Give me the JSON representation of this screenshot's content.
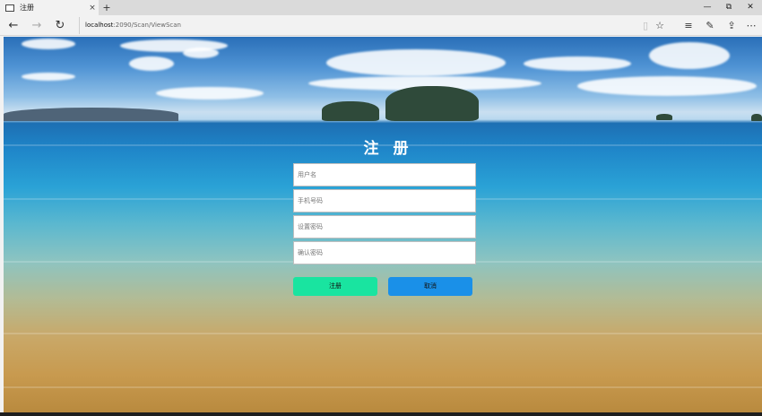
{
  "browser": {
    "tab_title": "注册",
    "new_tab": "+",
    "tab_close": "×",
    "window_controls": {
      "minimize": "—",
      "maximize": "⧉",
      "close": "✕"
    },
    "nav": {
      "back": "←",
      "forward": "→",
      "refresh": "↻"
    },
    "url_host": "localhost",
    "url_path": ":2090/Scan/ViewScan",
    "tools": {
      "reading_view": "▯",
      "favorite": "☆",
      "hub": "≡",
      "notes": "✎",
      "share": "⇪",
      "more": "⋯"
    }
  },
  "form": {
    "title": "注 册",
    "username_placeholder": "用户名",
    "phone_placeholder": "手机号码",
    "password_placeholder": "设置密码",
    "confirm_placeholder": "确认密码",
    "register_label": "注册",
    "cancel_label": "取消",
    "register_color": "#19e4a0",
    "cancel_color": "#1a90e8"
  }
}
